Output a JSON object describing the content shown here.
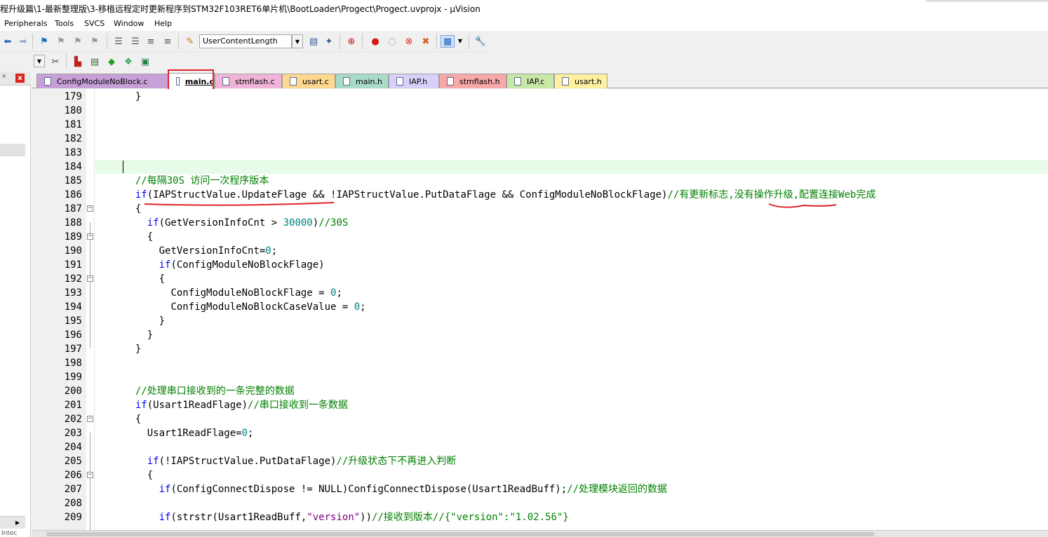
{
  "window": {
    "title": "程升级篇\\1-最新整理版\\3-移植远程定时更新程序到STM32F103RET6单片机\\BootLoader\\Progect\\Progect.uvprojx - µVision"
  },
  "menu": [
    "Peripherals",
    "Tools",
    "SVCS",
    "Window",
    "Help"
  ],
  "toolbar": {
    "target_combo": "UserContentLength"
  },
  "left_panel": {
    "pin_glyph": "ᵖ",
    "close_glyph": "x",
    "bottom_label": "Intec"
  },
  "tabs": [
    {
      "label": "ConfigModuleNoBlock.c",
      "color": "#c8a0d8",
      "active": false
    },
    {
      "label": "main.c",
      "color": "#ffffff",
      "active": true
    },
    {
      "label": "stmflash.c",
      "color": "#f0b4d8",
      "active": false
    },
    {
      "label": "usart.c",
      "color": "#ffd890",
      "active": false
    },
    {
      "label": "main.h",
      "color": "#a8dcc8",
      "active": false
    },
    {
      "label": "IAP.h",
      "color": "#d8d0f8",
      "active": false
    },
    {
      "label": "stmflash.h",
      "color": "#f8a8a8",
      "active": false
    },
    {
      "label": "IAP.c",
      "color": "#c8e8a8",
      "active": false
    },
    {
      "label": "usart.h",
      "color": "#fff0a0",
      "active": false
    }
  ],
  "code": {
    "line_numbers": [
      "179",
      "180",
      "181",
      "182",
      "183",
      "184",
      "185",
      "186",
      "187",
      "188",
      "189",
      "190",
      "191",
      "192",
      "193",
      "194",
      "195",
      "196",
      "197",
      "198",
      "199",
      "200",
      "201",
      "202",
      "203",
      "204",
      "205",
      "206",
      "207",
      "208",
      "209"
    ],
    "l179": "}",
    "l185": "//每隔30S 访问一次程序版本",
    "l186_kw": "if",
    "l186_code": "(IAPStructValue.UpdateFlage && !IAPStructValue.PutDataFlage && ConfigModuleNoBlockFlage)",
    "l186_cm": "//有更新标志,没有操作升级,配置连接Web完成",
    "l187": "{",
    "l188_kw": "if",
    "l188_code": "(GetVersionInfoCnt > ",
    "l188_num": "30000",
    "l188_code2": ")",
    "l188_cm": "//30S",
    "l189": "{",
    "l190_code": "GetVersionInfoCnt=",
    "l190_num": "0",
    "l190_end": ";",
    "l191_kw": "if",
    "l191_code": "(ConfigModuleNoBlockFlage)",
    "l192": "{",
    "l193_code": "ConfigModuleNoBlockFlage = ",
    "l193_num": "0",
    "l193_end": ";",
    "l194_code": "ConfigModuleNoBlockCaseValue = ",
    "l194_num": "0",
    "l194_end": ";",
    "l195": "}",
    "l196": "}",
    "l197": "}",
    "l200": "//处理串口接收到的一条完整的数据",
    "l201_kw": "if",
    "l201_code": "(Usart1ReadFlage)",
    "l201_cm": "//串口接收到一条数据",
    "l202": "{",
    "l203_code": "Usart1ReadFlage=",
    "l203_num": "0",
    "l203_end": ";",
    "l205_kw": "if",
    "l205_code": "(!IAPStructValue.PutDataFlage)",
    "l205_cm": "//升级状态下不再进入判断",
    "l206": "{",
    "l207_kw": "if",
    "l207_code": "(ConfigConnectDispose != NULL)ConfigConnectDispose(Usart1ReadBuff);",
    "l207_cm": "//处理模块返回的数据",
    "l209_kw": "if",
    "l209_code": "(strstr(Usart1ReadBuff,",
    "l209_str": "\"version\"",
    "l209_code2": "))",
    "l209_cm": "//接收到版本//{\"version\":\"1.02.56\"}"
  },
  "colors": {
    "keyword": "#0000ff",
    "comment": "#008000",
    "number": "#008080",
    "string": "#800080",
    "highlight_box": "#e0242a",
    "current_line": "#e8fbe8"
  }
}
